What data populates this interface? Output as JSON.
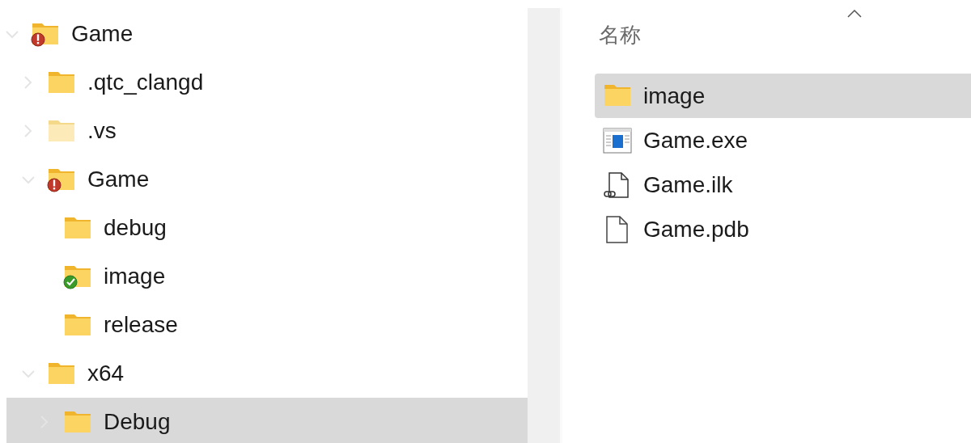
{
  "tree": [
    {
      "label": "Game",
      "expandable": true,
      "expanded": true,
      "warning": true,
      "synced": false,
      "hidden": false,
      "selected": false,
      "children": [
        {
          "label": ".qtc_clangd",
          "expandable": true,
          "expanded": false,
          "warning": false,
          "synced": false,
          "hidden": false,
          "selected": false
        },
        {
          "label": ".vs",
          "expandable": true,
          "expanded": false,
          "warning": false,
          "synced": false,
          "hidden": true,
          "selected": false
        },
        {
          "label": "Game",
          "expandable": true,
          "expanded": true,
          "warning": true,
          "synced": false,
          "hidden": false,
          "selected": false,
          "children": [
            {
              "label": "debug",
              "expandable": false,
              "warning": false,
              "synced": false,
              "hidden": false,
              "selected": false
            },
            {
              "label": "image",
              "expandable": false,
              "warning": false,
              "synced": true,
              "hidden": false,
              "selected": false
            },
            {
              "label": "release",
              "expandable": false,
              "warning": false,
              "synced": false,
              "hidden": false,
              "selected": false
            }
          ]
        },
        {
          "label": "x64",
          "expandable": true,
          "expanded": true,
          "warning": false,
          "synced": false,
          "hidden": false,
          "selected": false,
          "children": [
            {
              "label": "Debug",
              "expandable": true,
              "expanded": false,
              "warning": false,
              "synced": false,
              "hidden": false,
              "selected": true
            }
          ]
        }
      ]
    }
  ],
  "file_list": {
    "column_header": "名称",
    "sort_ascending": true,
    "files": [
      {
        "name": "image",
        "kind": "folder",
        "selected": true
      },
      {
        "name": "Game.exe",
        "kind": "exe",
        "selected": false
      },
      {
        "name": "Game.ilk",
        "kind": "link",
        "selected": false
      },
      {
        "name": "Game.pdb",
        "kind": "blank",
        "selected": false
      }
    ]
  }
}
